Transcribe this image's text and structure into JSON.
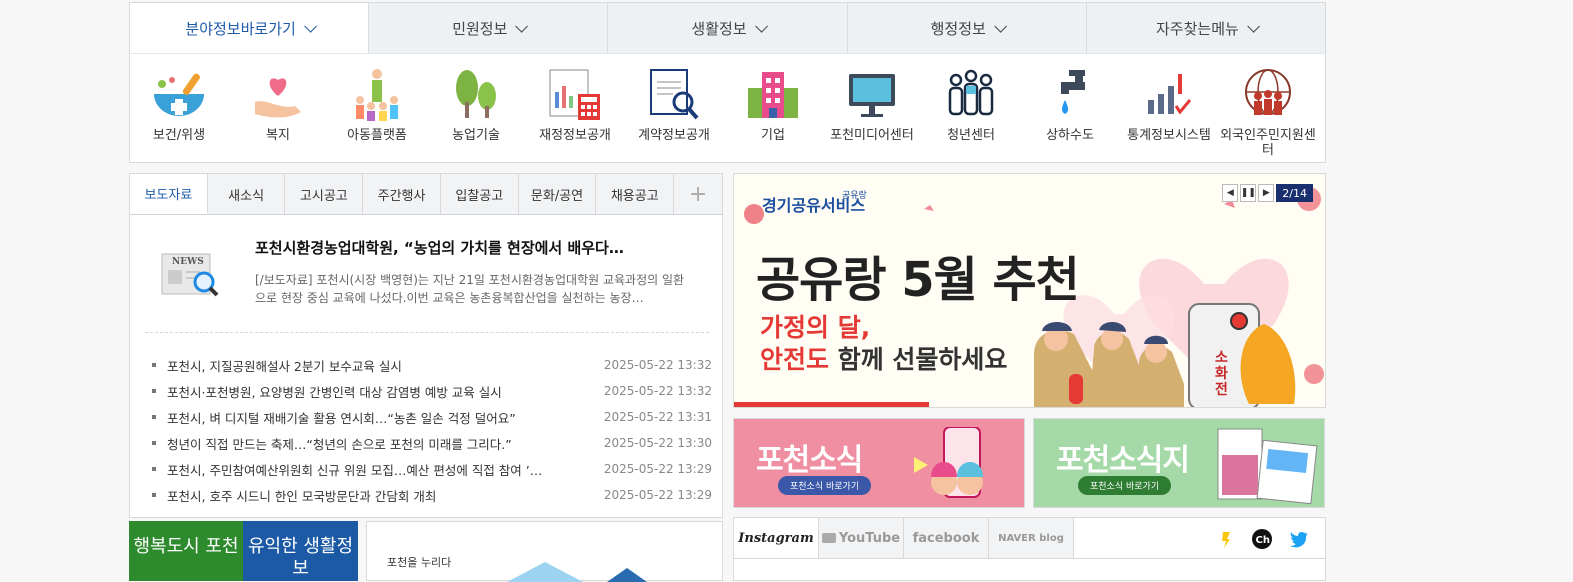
{
  "top_tabs": [
    "분야정보바로가기",
    "민원정보",
    "생활정보",
    "행정정보",
    "자주찾는메뉴"
  ],
  "quick_menu": [
    {
      "label": "보건/위생",
      "icon": "health-bowl-icon"
    },
    {
      "label": "복지",
      "icon": "welfare-heart-hand-icon"
    },
    {
      "label": "아동플랫폼",
      "icon": "children-family-icon"
    },
    {
      "label": "농업기술",
      "icon": "trees-icon"
    },
    {
      "label": "재정정보공개",
      "icon": "finance-calculator-icon"
    },
    {
      "label": "계약정보공개",
      "icon": "contract-magnifier-icon"
    },
    {
      "label": "기업",
      "icon": "building-icon"
    },
    {
      "label": "포천미디어센터",
      "icon": "monitor-icon"
    },
    {
      "label": "청년센터",
      "icon": "people-group-icon"
    },
    {
      "label": "상하수도",
      "icon": "water-faucet-icon"
    },
    {
      "label": "통계정보시스템",
      "icon": "bar-chart-icon"
    },
    {
      "label": "외국인주민지원센터",
      "icon": "globe-people-icon"
    }
  ],
  "news": {
    "tabs": [
      "보도자료",
      "새소식",
      "고시공고",
      "주간행사",
      "입찰공고",
      "문화/공연",
      "채용공고"
    ],
    "plus_label": "+",
    "news_badge": "NEWS",
    "featured_title": "포천시환경농업대학원, “농업의 가치를 현장에서 배우다…",
    "featured_desc": "[/보도자료] 포천시(시장 백영현)는 지난 21일 포천시환경농업대학원 교육과정의 일환으로 현장 중심 교육에 나섰다.이번 교육은 농촌융복합산업을 실천하는 농장…",
    "items": [
      {
        "title": "포천시, 지질공원해설사 2분기 보수교육 실시",
        "date": "2025-05-22 13:32"
      },
      {
        "title": "포천시·포천병원, 요양병원 간병인력 대상 감염병 예방 교육 실시",
        "date": "2025-05-22 13:32"
      },
      {
        "title": "포천시, 벼 디지털 재배기술 활용 연시회…“농촌 일손 걱정 덜어요”",
        "date": "2025-05-22 13:31"
      },
      {
        "title": "청년이 직접 만드는 축제…“청년의 손으로 포천의 미래를 그리다.”",
        "date": "2025-05-22 13:30"
      },
      {
        "title": "포천시, 주민참여예산위원회 신규 위원 모집…예산 편성에 직접 참여 ’…",
        "date": "2025-05-22 13:29"
      },
      {
        "title": "포천시, 호주 시드니 한인 모국방문단과 간담회 개최",
        "date": "2025-05-22 13:29"
      }
    ]
  },
  "banner": {
    "logo_main": "경기공유서비스",
    "logo_sub": "공유랑",
    "headline": "공유랑 5월 추천",
    "line1": "가정의 달,",
    "line2_strong": "안전도",
    "line2_rest": " 함께 선물하세요",
    "extinguisher_label": "소화전",
    "counter": "2/14"
  },
  "small_banners": [
    {
      "title": "포천소식",
      "button": "포천소식 바로가기",
      "color": "#f08ea2"
    },
    {
      "title": "포천소식지",
      "button": "포천소식 바로가기",
      "color": "#a6d9a8"
    }
  ],
  "bottom": {
    "green_label": "행복도시 포천",
    "blue_label": "유익한 생활정보",
    "promo_text": "포천을 누리다"
  },
  "social": {
    "tabs": [
      "Instagram",
      "YouTube",
      "facebook",
      "NAVER blog"
    ]
  }
}
